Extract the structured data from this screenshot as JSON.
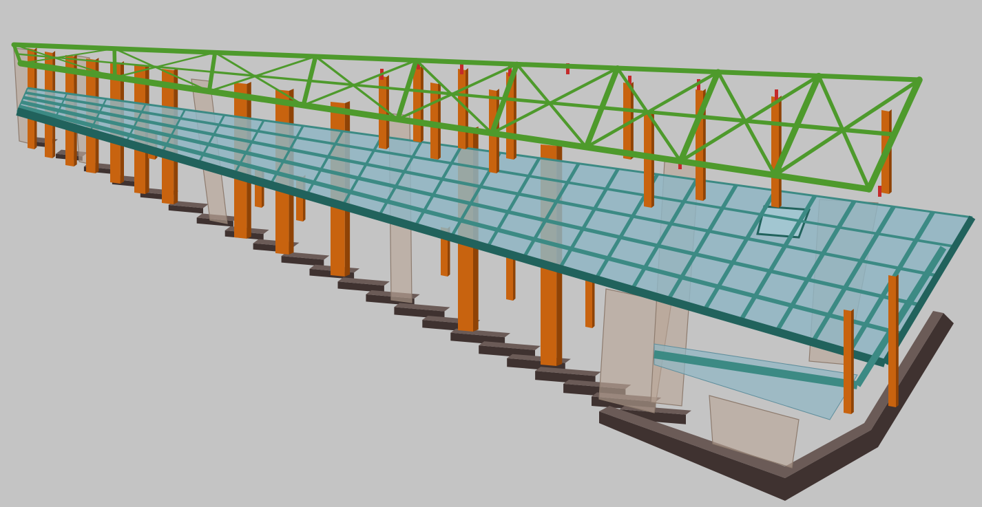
{
  "viewport": {
    "background_color": "#c4c4c4"
  },
  "colors": {
    "footing_top": "#6b5b57",
    "footing_side": "#3f3230",
    "wall_fill": "#b9a596",
    "wall_edge": "#8d7b6e",
    "column_fill": "#c8630f",
    "column_shade": "#8f4306",
    "slab_fill": "#8fb6c4",
    "slab_edge": "#5f8e9c",
    "beam_fill": "#3c8a84",
    "beam_edge": "#21625c",
    "truss_fill": "#4e9a2c",
    "truss_edge": "#2f6a17",
    "connector": "#c42a2a"
  },
  "model": {
    "description_visible": false,
    "layers": [
      {
        "name": "foundation",
        "element_icon": "footing-shape"
      },
      {
        "name": "shear-walls",
        "element_icon": "wall-panel-shape"
      },
      {
        "name": "columns",
        "element_icon": "column-shape"
      },
      {
        "name": "floor-slabs",
        "element_icon": "slab-shape"
      },
      {
        "name": "floor-beams",
        "element_icon": "beam-shape"
      },
      {
        "name": "roof-truss",
        "element_icon": "truss-shape"
      }
    ]
  }
}
